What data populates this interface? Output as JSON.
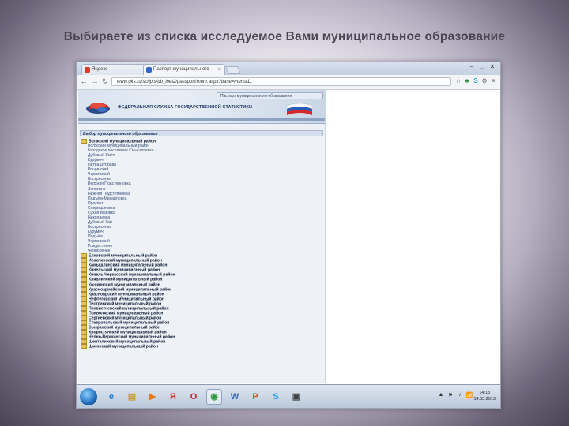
{
  "slide": {
    "title": "Выбираете из списка исследуемое Вами муниципальное образование"
  },
  "browser": {
    "tabs": [
      {
        "label": "Яндекс",
        "favicon_color": "#d23a2a"
      },
      {
        "label": "Паспорт муниципального",
        "favicon_color": "#2a66c2"
      }
    ],
    "window_controls": [
      "–",
      "□",
      "✕"
    ],
    "nav_icons": {
      "back": "←",
      "forward": "→",
      "reload": "↻"
    },
    "url": "www.gks.ru/scripts/db_inet2/passport/munr.aspx?base=munst11",
    "toolbar_icons": [
      "star-icon",
      "extension-icon",
      "skype-icon",
      "gear-icon",
      "menu-icon"
    ]
  },
  "site": {
    "top_button": "Паспорт муниципального образования",
    "banner_text": "ФЕДЕРАЛЬНАЯ СЛУЖБА ГОСУДАРСТВЕННОЙ СТАТИСТИКИ",
    "selector_header": "Выбор муниципального образования",
    "tree": [
      {
        "label": "Волжский муниципальный район",
        "level": "top",
        "folder": true
      },
      {
        "label": "Волжский муниципальный район",
        "level": "sub",
        "folder": false
      },
      {
        "label": "Городское поселение Смышляевка",
        "level": "sub",
        "folder": false
      },
      {
        "label": "Дубовый Умёт",
        "level": "sub",
        "folder": false
      },
      {
        "label": "Курумоч",
        "level": "sub",
        "folder": false
      },
      {
        "label": "Петра Дубрава",
        "level": "sub",
        "folder": false
      },
      {
        "label": "Рощинский",
        "level": "sub",
        "folder": false
      },
      {
        "label": "Черновский",
        "level": "sub",
        "folder": false
      },
      {
        "label": "Воскресенка",
        "level": "sub",
        "folder": false
      },
      {
        "label": "Верхняя Подстепновка",
        "level": "sub",
        "folder": false
      },
      {
        "label": "Лопатино",
        "level": "sub",
        "folder": false
      },
      {
        "label": "Нижняя Подстепновка",
        "level": "sub",
        "folder": false
      },
      {
        "label": "Подъём-Михайловка",
        "level": "sub",
        "folder": false
      },
      {
        "label": "Просвет",
        "level": "sub",
        "folder": false
      },
      {
        "label": "Спиридоновка",
        "level": "sub",
        "folder": false
      },
      {
        "label": "Сухая Вязовка",
        "level": "sub",
        "folder": false
      },
      {
        "label": "Николаевка",
        "level": "sub",
        "folder": false
      },
      {
        "label": "Дубовый Гай",
        "level": "sub",
        "folder": false
      },
      {
        "label": "Воскресенка",
        "level": "sub",
        "folder": false
      },
      {
        "label": "Курумоч",
        "level": "sub",
        "folder": false
      },
      {
        "label": "Подъём",
        "level": "sub",
        "folder": false
      },
      {
        "label": "Черновский",
        "level": "sub",
        "folder": false
      },
      {
        "label": "Рождествено",
        "level": "sub",
        "folder": false
      },
      {
        "label": "Черноречье",
        "level": "sub",
        "folder": false
      },
      {
        "label": "Елховский муниципальный район",
        "level": "top",
        "folder": true
      },
      {
        "label": "Исаклинский муниципальный район",
        "level": "top",
        "folder": true
      },
      {
        "label": "Камышлинский муниципальный район",
        "level": "top",
        "folder": true
      },
      {
        "label": "Кинельский муниципальный район",
        "level": "top",
        "folder": true
      },
      {
        "label": "Кинель-Черкасский муниципальный район",
        "level": "top",
        "folder": true
      },
      {
        "label": "Клявлинский муниципальный район",
        "level": "top",
        "folder": true
      },
      {
        "label": "Кошкинский муниципальный район",
        "level": "top",
        "folder": true
      },
      {
        "label": "Красноармейский муниципальный район",
        "level": "top",
        "folder": true
      },
      {
        "label": "Красноярский муниципальный район",
        "level": "top",
        "folder": true
      },
      {
        "label": "Нефтегорский муниципальный район",
        "level": "top",
        "folder": true
      },
      {
        "label": "Пестравский муниципальный район",
        "level": "top",
        "folder": true
      },
      {
        "label": "Похвистневский муниципальный район",
        "level": "top",
        "folder": true
      },
      {
        "label": "Приволжский муниципальный район",
        "level": "top",
        "folder": true
      },
      {
        "label": "Сергиевский муниципальный район",
        "level": "top",
        "folder": true
      },
      {
        "label": "Ставропольский муниципальный район",
        "level": "top",
        "folder": true
      },
      {
        "label": "Сызранский муниципальный район",
        "level": "top",
        "folder": true
      },
      {
        "label": "Хворостянский муниципальный район",
        "level": "top",
        "folder": true
      },
      {
        "label": "Челно-Вершинский муниципальный район",
        "level": "top",
        "folder": true
      },
      {
        "label": "Шенталинский муниципальный район",
        "level": "top",
        "folder": true
      },
      {
        "label": "Шигонский муниципальный район",
        "level": "top",
        "folder": true
      }
    ]
  },
  "taskbar": {
    "apps": [
      {
        "name": "ie-icon",
        "glyph": "e",
        "color": "#1e78d0"
      },
      {
        "name": "folder-icon",
        "glyph": "▤",
        "color": "#c99a2e"
      },
      {
        "name": "media-player-icon",
        "glyph": "▶",
        "color": "#e07a1a"
      },
      {
        "name": "yandex-icon",
        "glyph": "Я",
        "color": "#d42a1e"
      },
      {
        "name": "opera-icon",
        "glyph": "O",
        "color": "#c91f2a"
      },
      {
        "name": "chrome-icon",
        "glyph": "◉",
        "color": "#2e9a3e"
      },
      {
        "name": "word-icon",
        "glyph": "W",
        "color": "#2a5fb0"
      },
      {
        "name": "powerpoint-icon",
        "glyph": "P",
        "color": "#c8501e"
      },
      {
        "name": "skype-icon",
        "glyph": "S",
        "color": "#1c9ee0"
      },
      {
        "name": "app-icon",
        "glyph": "▣",
        "color": "#444"
      }
    ],
    "tray_icons": [
      "▲",
      "⚑",
      "♪",
      "📶"
    ],
    "clock_time": "14:18",
    "clock_date": "14.03.2013"
  }
}
